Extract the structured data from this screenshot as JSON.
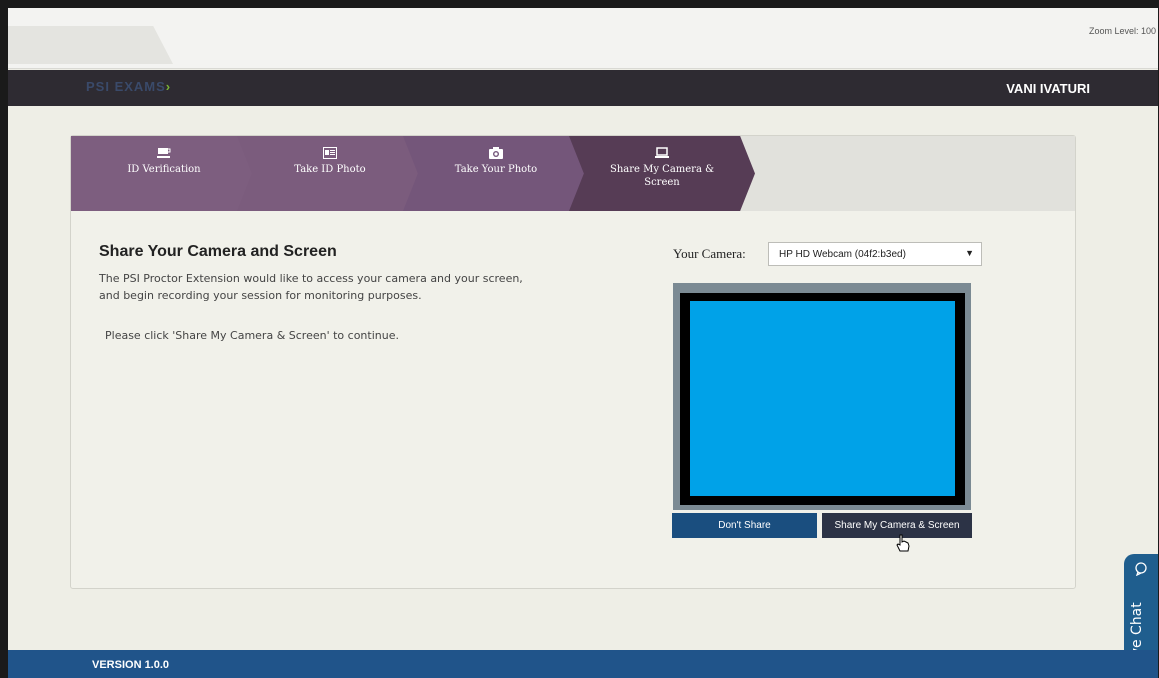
{
  "browser": {
    "zoom_label": "Zoom Level: 100"
  },
  "header": {
    "logo_text": "PSI EXAMS",
    "user_name": "VANI IVATURI"
  },
  "stepper": {
    "steps": [
      {
        "label": "ID Verification",
        "icon": "cup-icon"
      },
      {
        "label": "Take ID Photo",
        "icon": "id-card-icon"
      },
      {
        "label": "Take Your Photo",
        "icon": "camera-icon"
      },
      {
        "label": "Share My Camera & Screen",
        "icon": "laptop-icon",
        "active": true
      }
    ]
  },
  "main": {
    "heading": "Share Your Camera and Screen",
    "description": "The PSI Proctor Extension would like to access your camera and your screen, and begin recording your session for monitoring purposes.",
    "instruction": "Please click 'Share My Camera & Screen' to continue."
  },
  "camera": {
    "label": "Your Camera:",
    "selected": "HP HD Webcam (04f2:b3ed)",
    "preview_color": "#00a2e8"
  },
  "buttons": {
    "dont_share": "Don't Share",
    "share": "Share My Camera & Screen"
  },
  "live_chat": {
    "label": "Live Chat"
  },
  "footer": {
    "version": "VERSION 1.0.0"
  }
}
